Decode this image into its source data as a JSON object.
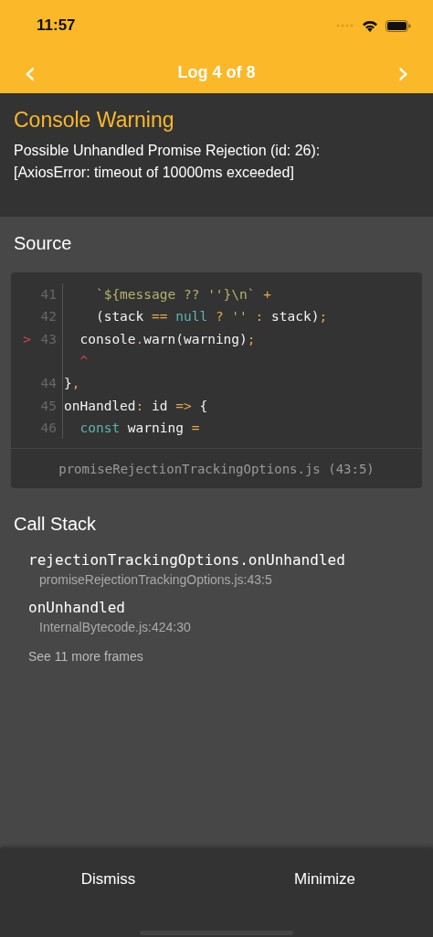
{
  "status_bar": {
    "time": "11:57"
  },
  "nav": {
    "title": "Log 4 of 8",
    "prev": "‹",
    "next": "›"
  },
  "warning": {
    "title": "Console Warning",
    "message": "Possible Unhandled Promise Rejection (id: 26):\n[AxiosError: timeout of 10000ms exceeded]"
  },
  "source": {
    "heading": "Source",
    "lines": [
      {
        "number": "41",
        "tokens": [
          {
            "text": "    `${message ?? ''}\\n` ",
            "kind": "string"
          },
          {
            "text": "+",
            "kind": "operator"
          }
        ]
      },
      {
        "number": "42",
        "tokens": [
          {
            "text": "    (stack ",
            "kind": "plain"
          },
          {
            "text": "==",
            "kind": "operator"
          },
          {
            "text": " null",
            "kind": "keyword"
          },
          {
            "text": " ?",
            "kind": "operator"
          },
          {
            "text": " ''",
            "kind": "string"
          },
          {
            "text": " :",
            "kind": "operator"
          },
          {
            "text": " stack)",
            "kind": "plain"
          },
          {
            "text": ";",
            "kind": "operator"
          }
        ]
      },
      {
        "number": "43",
        "marker": ">",
        "tokens": [
          {
            "text": "  console",
            "kind": "plain"
          },
          {
            "text": ".",
            "kind": "operator"
          },
          {
            "text": "warn(warning)",
            "kind": "plain"
          },
          {
            "text": ";",
            "kind": "operator"
          }
        ]
      },
      {
        "tokens": [
          {
            "text": "  ^",
            "kind": "caret"
          }
        ]
      },
      {
        "number": "44",
        "tokens": [
          {
            "text": "}",
            "kind": "plain"
          },
          {
            "text": ",",
            "kind": "operator"
          }
        ]
      },
      {
        "number": "45",
        "tokens": [
          {
            "text": "onHandled",
            "kind": "plain"
          },
          {
            "text": ":",
            "kind": "operator"
          },
          {
            "text": " id ",
            "kind": "plain"
          },
          {
            "text": "=>",
            "kind": "operator"
          },
          {
            "text": " {",
            "kind": "plain"
          }
        ]
      },
      {
        "number": "46",
        "tokens": [
          {
            "text": "  const",
            "kind": "keyword"
          },
          {
            "text": " warning ",
            "kind": "plain"
          },
          {
            "text": "=",
            "kind": "operator"
          }
        ]
      }
    ],
    "file": "promiseRejectionTrackingOptions.js (43:5)"
  },
  "call_stack": {
    "heading": "Call Stack",
    "frames": [
      {
        "name": "rejectionTrackingOptions.onUnhandled",
        "location": "promiseRejectionTrackingOptions.js:43:5"
      },
      {
        "name": "onUnhandled",
        "location": "InternalBytecode.js:424:30"
      }
    ],
    "more": "See 11 more frames"
  },
  "footer": {
    "buttons": [
      "Dismiss",
      "Minimize"
    ]
  }
}
